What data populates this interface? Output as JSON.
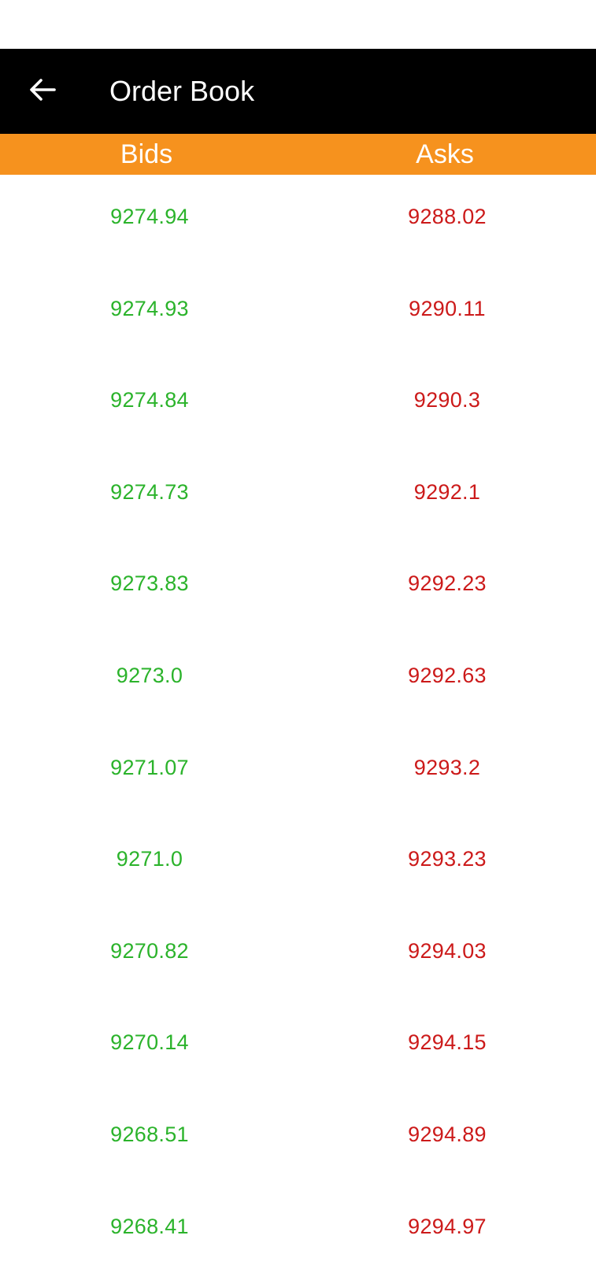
{
  "app_bar": {
    "title": "Order Book",
    "back_icon": "arrow-left-icon"
  },
  "columns": {
    "bids_label": "Bids",
    "asks_label": "Asks"
  },
  "colors": {
    "app_bar_bg": "#000000",
    "header_bg": "#f6921e",
    "bid_color": "#2bb32b",
    "ask_color": "#cc1a1a"
  },
  "orders": [
    {
      "bid": "9274.94",
      "ask": "9288.02"
    },
    {
      "bid": "9274.93",
      "ask": "9290.11"
    },
    {
      "bid": "9274.84",
      "ask": "9290.3"
    },
    {
      "bid": "9274.73",
      "ask": "9292.1"
    },
    {
      "bid": "9273.83",
      "ask": "9292.23"
    },
    {
      "bid": "9273.0",
      "ask": "9292.63"
    },
    {
      "bid": "9271.07",
      "ask": "9293.2"
    },
    {
      "bid": "9271.0",
      "ask": "9293.23"
    },
    {
      "bid": "9270.82",
      "ask": "9294.03"
    },
    {
      "bid": "9270.14",
      "ask": "9294.15"
    },
    {
      "bid": "9268.51",
      "ask": "9294.89"
    },
    {
      "bid": "9268.41",
      "ask": "9294.97"
    }
  ]
}
